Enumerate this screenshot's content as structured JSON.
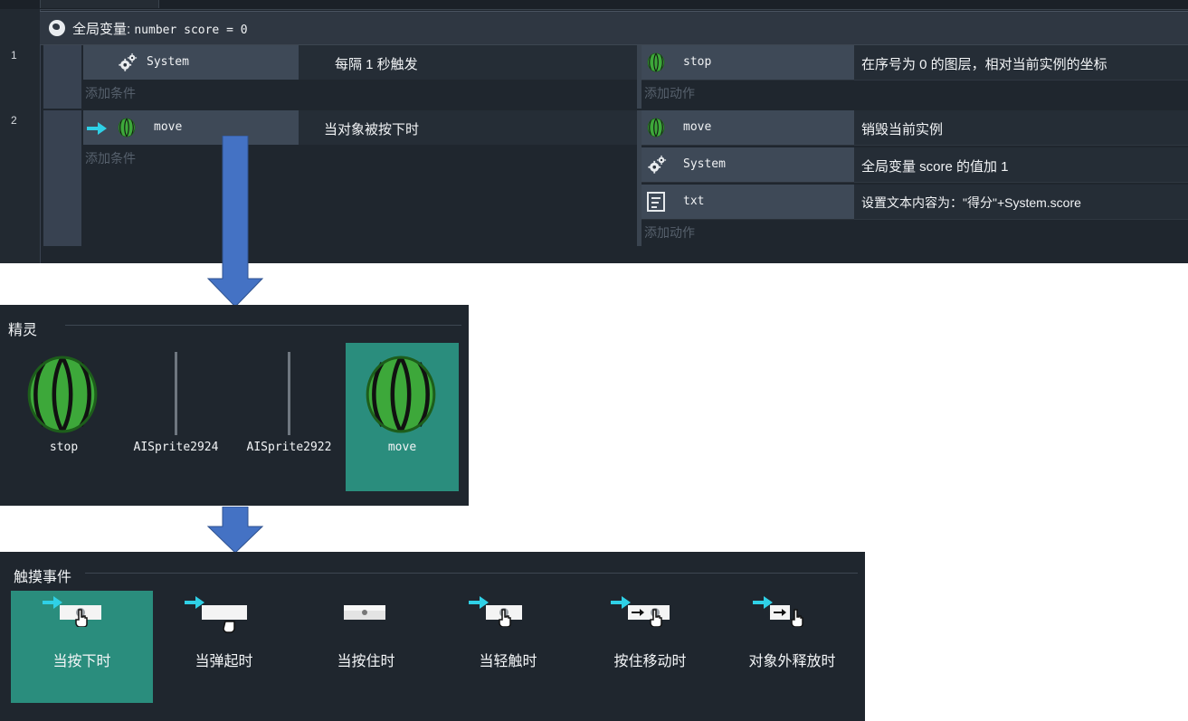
{
  "event_sheet": {
    "global_variable": {
      "prefix": "全局变量:",
      "declaration": "number  score = 0"
    },
    "events": [
      {
        "number": "1",
        "conditions": [
          {
            "object": "System",
            "icon": "gear-icon",
            "description": "每隔 1 秒触发"
          }
        ],
        "add_condition": "添加条件",
        "actions": [
          {
            "object": "stop",
            "icon": "watermelon-icon",
            "description": "在序号为 0 的图层，相对当前实例的坐标"
          }
        ],
        "add_action": "添加动作"
      },
      {
        "number": "2",
        "conditions": [
          {
            "object": "move",
            "icon": "watermelon-icon",
            "trigger_icon": "trigger-arrow-icon",
            "description": "当对象被按下时"
          }
        ],
        "add_condition": "添加条件",
        "actions": [
          {
            "object": "move",
            "icon": "watermelon-icon",
            "description": "销毁当前实例"
          },
          {
            "object": "System",
            "icon": "gear-icon",
            "description": "全局变量 score 的值加 1"
          },
          {
            "object": "txt",
            "icon": "text-icon",
            "description": "设置文本内容为：\"得分\"+System.score"
          }
        ],
        "add_action": "添加动作"
      }
    ]
  },
  "sprite_panel": {
    "title": "精灵",
    "items": [
      {
        "name": "stop",
        "icon": "watermelon-icon",
        "selected": false
      },
      {
        "name": "AISprite2924",
        "icon": "blank-sprite",
        "selected": false
      },
      {
        "name": "AISprite2922",
        "icon": "blank-sprite",
        "selected": false
      },
      {
        "name": "move",
        "icon": "watermelon-icon",
        "selected": true
      }
    ]
  },
  "touch_panel": {
    "title": "触摸事件",
    "items": [
      {
        "label": "当按下时",
        "icon": "touch-press-icon",
        "selected": true
      },
      {
        "label": "当弹起时",
        "icon": "touch-release-icon",
        "selected": false
      },
      {
        "label": "当按住时",
        "icon": "touch-hold-icon",
        "selected": false
      },
      {
        "label": "当轻触时",
        "icon": "touch-tap-icon",
        "selected": false
      },
      {
        "label": "按住移动时",
        "icon": "touch-drag-icon",
        "selected": false
      },
      {
        "label": "对象外释放时",
        "icon": "touch-release-outside-icon",
        "selected": false
      }
    ]
  },
  "colors": {
    "panel_bg": "#1f262e",
    "selected": "#2a8d7d",
    "flow_arrow": "#4472c4",
    "trigger_arrow": "#2fd0e6",
    "melon_green": "#3da83a"
  }
}
